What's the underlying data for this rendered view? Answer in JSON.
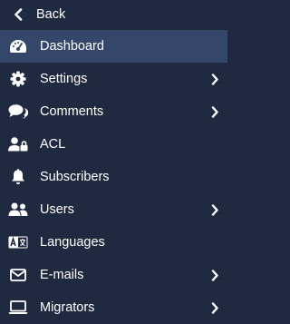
{
  "back": {
    "label": "Back",
    "icon": "chevron-left-icon"
  },
  "items": [
    {
      "label": "Dashboard",
      "icon": "gauge-icon",
      "active": true,
      "has_submenu": false
    },
    {
      "label": "Settings",
      "icon": "gear-icon",
      "active": false,
      "has_submenu": true
    },
    {
      "label": "Comments",
      "icon": "comments-icon",
      "active": false,
      "has_submenu": true
    },
    {
      "label": "ACL",
      "icon": "user-lock-icon",
      "active": false,
      "has_submenu": false
    },
    {
      "label": "Subscribers",
      "icon": "bell-icon",
      "active": false,
      "has_submenu": false
    },
    {
      "label": "Users",
      "icon": "users-icon",
      "active": false,
      "has_submenu": true
    },
    {
      "label": "Languages",
      "icon": "language-icon",
      "active": false,
      "has_submenu": false
    },
    {
      "label": "E-mails",
      "icon": "envelope-icon",
      "active": false,
      "has_submenu": true
    },
    {
      "label": "Migrators",
      "icon": "laptop-icon",
      "active": false,
      "has_submenu": true
    }
  ],
  "colors": {
    "background": "#1f2940",
    "active_background": "#34476a",
    "text": "#ffffff"
  }
}
